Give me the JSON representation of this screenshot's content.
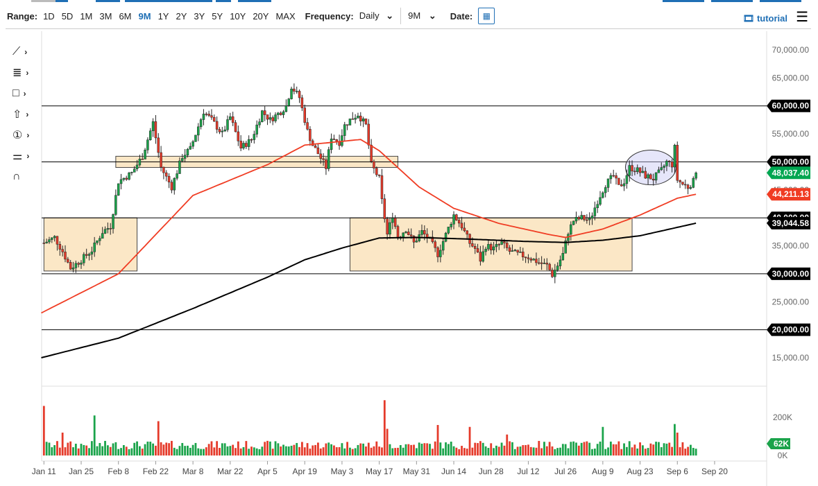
{
  "toolbar": {
    "range_label": "Range:",
    "ranges": [
      "1D",
      "5D",
      "1M",
      "3M",
      "6M",
      "9M",
      "1Y",
      "2Y",
      "3Y",
      "5Y",
      "10Y",
      "20Y",
      "MAX"
    ],
    "active_range": "9M",
    "frequency_label": "Frequency:",
    "frequency_value": "Daily",
    "period_value": "9M",
    "date_label": "Date:",
    "tutorial_label": "tutorial"
  },
  "tools": [
    "trendline-icon",
    "fib-icon",
    "rectangle-icon",
    "arrow-icon",
    "number-icon",
    "measure-icon",
    "magnet-icon"
  ],
  "chart_data": {
    "type": "candlestick",
    "y_ticks": [
      "70,000.00",
      "65,000.00",
      "60,000.00",
      "55,000.00",
      "50,000.00",
      "45,000.00",
      "40,000.00",
      "35,000.00",
      "30,000.00",
      "25,000.00",
      "20,000.00",
      "15,000.00"
    ],
    "y_tick_values": [
      70000,
      65000,
      60000,
      55000,
      50000,
      45000,
      40000,
      35000,
      30000,
      25000,
      20000,
      15000
    ],
    "ylim": [
      10000,
      72500
    ],
    "x_ticks": [
      "Jan 11",
      "Jan 25",
      "Feb 8",
      "Feb 22",
      "Mar 8",
      "Mar 22",
      "Apr 5",
      "Apr 19",
      "May 3",
      "May 17",
      "May 31",
      "Jun 14",
      "Jun 28",
      "Jul 12",
      "Jul 26",
      "Aug 9",
      "Aug 23",
      "Sep 6",
      "Sep 20"
    ],
    "price_anchors": [
      [
        0,
        35500
      ],
      [
        4,
        36500
      ],
      [
        7,
        34000
      ],
      [
        10,
        31000
      ],
      [
        14,
        32500
      ],
      [
        18,
        34200
      ],
      [
        22,
        37500
      ],
      [
        25,
        38500
      ],
      [
        28,
        46500
      ],
      [
        33,
        48000
      ],
      [
        37,
        51000
      ],
      [
        41,
        57000
      ],
      [
        44,
        49000
      ],
      [
        48,
        45500
      ],
      [
        52,
        51000
      ],
      [
        55,
        52300
      ],
      [
        60,
        59000
      ],
      [
        63,
        57500
      ],
      [
        67,
        55000
      ],
      [
        70,
        58000
      ],
      [
        74,
        52500
      ],
      [
        78,
        54000
      ],
      [
        82,
        59000
      ],
      [
        85,
        57500
      ],
      [
        89,
        59000
      ],
      [
        91,
        60000
      ],
      [
        93,
        63500
      ],
      [
        96,
        61500
      ],
      [
        99,
        55500
      ],
      [
        101,
        53000
      ],
      [
        103,
        51500
      ],
      [
        106,
        49000
      ],
      [
        108,
        54500
      ],
      [
        111,
        53500
      ],
      [
        113,
        56500
      ],
      [
        115,
        57500
      ],
      [
        118,
        58500
      ],
      [
        121,
        56500
      ],
      [
        123,
        49500
      ],
      [
        126,
        47000
      ],
      [
        127,
        43000
      ],
      [
        129,
        37000
      ],
      [
        131,
        40500
      ],
      [
        133,
        36500
      ],
      [
        136,
        38000
      ],
      [
        139,
        35500
      ],
      [
        142,
        37500
      ],
      [
        145,
        36000
      ],
      [
        148,
        33500
      ],
      [
        151,
        37000
      ],
      [
        154,
        40500
      ],
      [
        157,
        38500
      ],
      [
        160,
        35500
      ],
      [
        162,
        34500
      ],
      [
        164,
        32500
      ],
      [
        166,
        35000
      ],
      [
        169,
        34500
      ],
      [
        172,
        35500
      ],
      [
        175,
        34000
      ],
      [
        178,
        33500
      ],
      [
        182,
        33000
      ],
      [
        186,
        32000
      ],
      [
        189,
        31500
      ],
      [
        191,
        29800
      ],
      [
        193,
        31500
      ],
      [
        195,
        33500
      ],
      [
        197,
        37500
      ],
      [
        199,
        39500
      ],
      [
        202,
        40000
      ],
      [
        205,
        39500
      ],
      [
        208,
        43000
      ],
      [
        211,
        46000
      ],
      [
        214,
        47500
      ],
      [
        216,
        45500
      ],
      [
        218,
        46500
      ],
      [
        220,
        49000
      ],
      [
        223,
        48500
      ],
      [
        226,
        47500
      ],
      [
        229,
        47000
      ],
      [
        232,
        48500
      ],
      [
        234,
        50000
      ],
      [
        236,
        49500
      ],
      [
        237,
        52500
      ],
      [
        238,
        46800
      ],
      [
        240,
        46000
      ],
      [
        242,
        45500
      ],
      [
        244,
        46500
      ],
      [
        245,
        48037
      ]
    ],
    "ma50": {
      "label": "44,211.13",
      "color": "#f03c23",
      "anchors": [
        [
          -1,
          23000
        ],
        [
          28,
          30000
        ],
        [
          56,
          44000
        ],
        [
          84,
          49500
        ],
        [
          98,
          53000
        ],
        [
          119,
          54000
        ],
        [
          126,
          52000
        ],
        [
          141,
          45500
        ],
        [
          154,
          41700
        ],
        [
          171,
          39000
        ],
        [
          190,
          37000
        ],
        [
          196,
          36500
        ],
        [
          210,
          38000
        ],
        [
          224,
          40500
        ],
        [
          238,
          43500
        ],
        [
          245,
          44211
        ]
      ]
    },
    "ma200": {
      "label": "39,044.58",
      "color": "#000000",
      "anchors": [
        [
          -1,
          15000
        ],
        [
          28,
          18500
        ],
        [
          56,
          23800
        ],
        [
          84,
          29400
        ],
        [
          98,
          32500
        ],
        [
          112,
          34600
        ],
        [
          126,
          36400
        ],
        [
          140,
          36500
        ],
        [
          160,
          36200
        ],
        [
          180,
          35800
        ],
        [
          196,
          35600
        ],
        [
          210,
          36000
        ],
        [
          224,
          36800
        ],
        [
          245,
          39044
        ]
      ]
    },
    "last_price": {
      "label": "48,037.40",
      "color": "#00a651"
    },
    "level_labels": [
      "60,000.00",
      "50,000.00",
      "40,000.00",
      "30,000.00",
      "20,000.00"
    ],
    "levels": [
      60000,
      50000,
      40000,
      30000,
      20000
    ],
    "zones": [
      {
        "from_day": 0,
        "to_day": 35,
        "low": 30500,
        "high": 40000
      },
      {
        "from_day": 27,
        "to_day": 133,
        "low": 49000,
        "high": 51000
      },
      {
        "from_day": 115,
        "to_day": 221,
        "low": 30500,
        "high": 40000
      }
    ],
    "ellipse": {
      "center_day": 228,
      "center_price": 49000,
      "day_radius": 9.5,
      "price_radius": 3100
    },
    "volume": {
      "ticks": [
        "200K",
        "0K"
      ],
      "tick_values": [
        200,
        0
      ],
      "last_label": "62K",
      "spikes": [
        [
          0,
          260
        ],
        [
          7,
          120
        ],
        [
          19,
          210
        ],
        [
          43,
          180
        ],
        [
          128,
          290
        ],
        [
          129,
          140
        ],
        [
          148,
          160
        ],
        [
          160,
          150
        ],
        [
          174,
          110
        ],
        [
          210,
          150
        ],
        [
          237,
          165
        ],
        [
          238,
          120
        ]
      ],
      "base": 55
    }
  }
}
